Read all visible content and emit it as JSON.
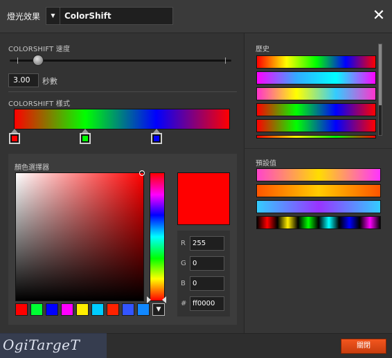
{
  "header": {
    "title": "燈光效果",
    "preset_value": "ColorShift",
    "close_label": "✕"
  },
  "speed": {
    "label": "COLORSHIFT 速度",
    "value": "3.00",
    "unit": "秒數",
    "slider_fraction": 0.1
  },
  "pattern": {
    "label": "COLORSHIFT 樣式",
    "stops": [
      {
        "color": "#ff0000"
      },
      {
        "color": "#00ff00"
      },
      {
        "color": "#0000ff"
      }
    ]
  },
  "picker": {
    "label": "顏色選擇器",
    "preview_color": "#ff0000",
    "r_label": "R",
    "g_label": "G",
    "b_label": "B",
    "hex_label": "#",
    "r": "255",
    "g": "0",
    "b": "0",
    "hex": "ff0000",
    "swatches": [
      "#ff0000",
      "#00ff33",
      "#0000ff",
      "#ff00ff",
      "#ffee00",
      "#00ccff",
      "#ff2200",
      "#3355ff",
      "#1188ff"
    ]
  },
  "history": {
    "label": "歷史",
    "gradients": [
      "linear-gradient(to right,#ff0000,#ffff00,#00ff00,#0000ff,#ff0000)",
      "linear-gradient(to right,#ff00ff,#33aaff,#00ffff,#ff00ff)",
      "linear-gradient(to right,#ff33cc,#ffff00,#33ccff,#ff33cc)",
      "linear-gradient(to right,#ff0000,#00ff00,#0000ff,#ff0000)",
      "linear-gradient(to right,#ff0000,#00ff00,#0000ff,#ff0000)",
      "linear-gradient(to right,#ff0000,#ffff00,#00ff00,#ff0000)"
    ]
  },
  "presets": {
    "label": "預設值",
    "gradients": [
      "linear-gradient(to right,#ff44cc,#ffdd00,#ff33ff)",
      "linear-gradient(to right,#ff5500,#ffcc00,#ff5500)",
      "linear-gradient(to right,#33ccff,#9933ff,#33ccff)",
      "linear-gradient(to right,#000,#ff0000,#000,#ffee00,#000,#00ff00,#000,#00ffff,#000,#0000ff,#000,#ff00ff,#000)"
    ]
  },
  "footer": {
    "watermark": "OgiTargeT",
    "ok_label": "關閉"
  }
}
